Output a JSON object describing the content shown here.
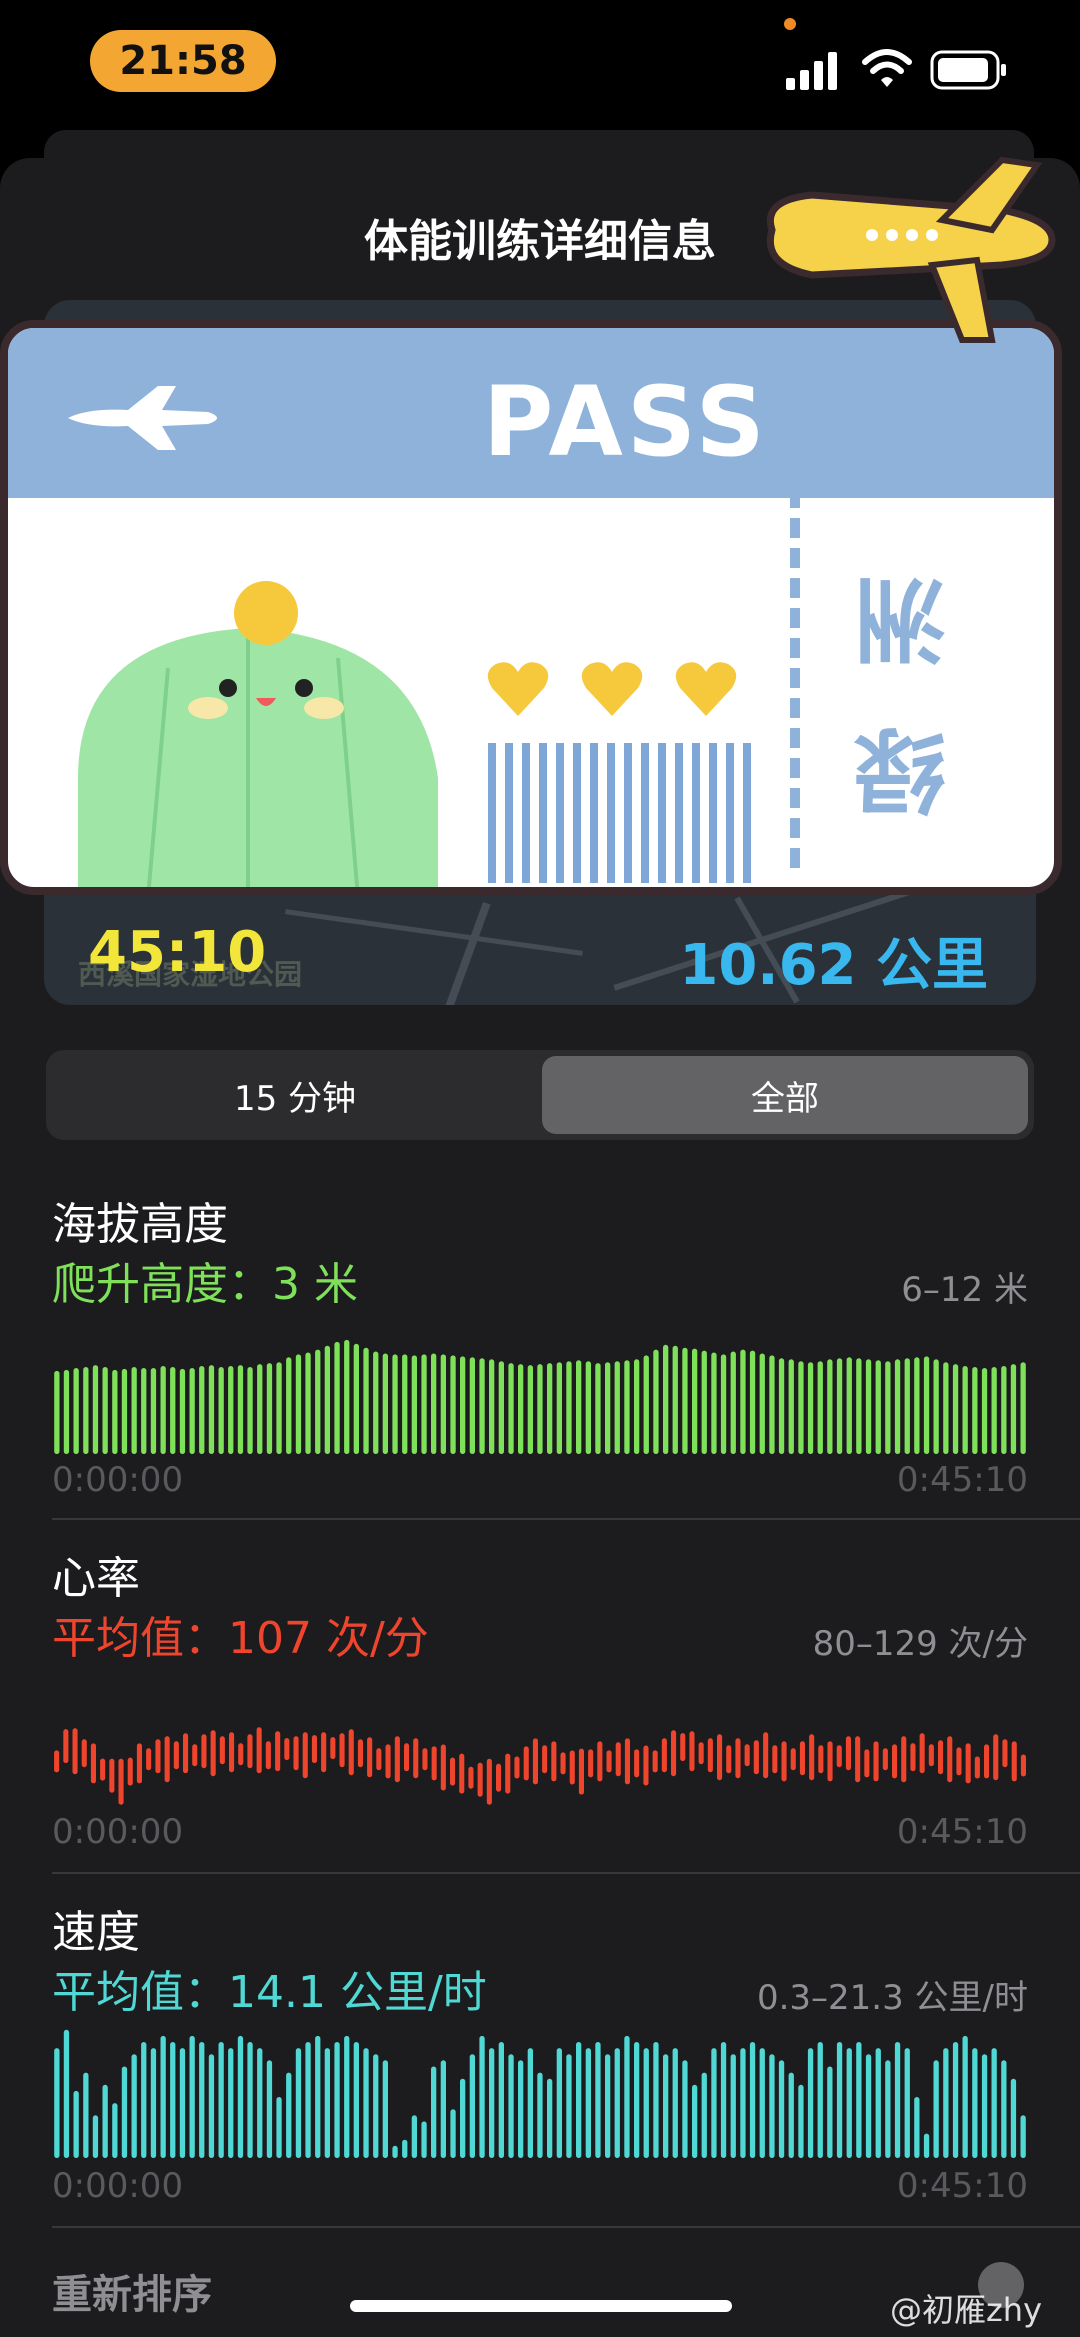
{
  "status_bar": {
    "time": "21:58",
    "icons": [
      "signal-icon",
      "wifi-icon",
      "battery-icon"
    ]
  },
  "sheet": {
    "title": "体能训练详细信息"
  },
  "map": {
    "duration": "45:10",
    "distance": "10.62 公里",
    "place_label": "西溪国家湿地公园"
  },
  "sticker": {
    "pass_text": "PASS",
    "destination": "绿洲"
  },
  "segmented": {
    "options": [
      "15 分钟",
      "全部"
    ],
    "selected": "全部"
  },
  "sections": [
    {
      "title": "海拔高度",
      "summary": "爬升高度：3 米",
      "range": "6–12 米",
      "axis_start": "0:00:00",
      "axis_end": "0:45:10",
      "color": "#7fe05a"
    },
    {
      "title": "心率",
      "summary": "平均值：107 次/分",
      "range": "80–129 次/分",
      "axis_start": "0:00:00",
      "axis_end": "0:45:10",
      "color": "#f0452d"
    },
    {
      "title": "速度",
      "summary": "平均值：14.1 公里/时",
      "range": "0.3–21.3 公里/时",
      "axis_start": "0:00:00",
      "axis_end": "0:45:10",
      "color": "#4fd8d4"
    }
  ],
  "footer": {
    "reorder_label": "重新排序",
    "watermark": "@初雁zhy"
  },
  "chart_data": [
    {
      "type": "bar",
      "title": "海拔高度",
      "ylabel": "米",
      "ylim": [
        0,
        12
      ],
      "x_range": [
        "0:00:00",
        "0:45:10"
      ],
      "values": [
        8.6,
        8.7,
        8.9,
        9.0,
        9.2,
        9.0,
        8.7,
        8.8,
        9.0,
        8.9,
        8.9,
        9.1,
        9.0,
        8.8,
        8.9,
        9.1,
        9.2,
        9.0,
        9.1,
        9.2,
        9.0,
        9.3,
        9.4,
        9.5,
        10.0,
        10.3,
        10.5,
        10.8,
        11.2,
        11.6,
        11.8,
        11.4,
        11.0,
        10.6,
        10.4,
        10.3,
        10.3,
        10.2,
        10.3,
        10.4,
        10.3,
        10.2,
        10.1,
        10.0,
        9.9,
        9.8,
        9.6,
        9.4,
        9.3,
        9.2,
        9.3,
        9.4,
        9.5,
        9.6,
        9.7,
        9.6,
        9.4,
        9.5,
        9.6,
        9.7,
        9.8,
        10.2,
        10.8,
        11.3,
        11.2,
        11.0,
        10.9,
        10.7,
        10.5,
        10.3,
        10.6,
        10.8,
        10.7,
        10.4,
        10.2,
        9.9,
        9.8,
        9.6,
        9.5,
        9.6,
        9.8,
        9.9,
        10.0,
        9.9,
        9.8,
        9.7,
        9.6,
        9.8,
        9.9,
        10.0,
        10.1,
        9.8,
        9.5,
        9.3,
        9.1,
        9.0,
        8.9,
        9.0,
        9.1,
        9.3,
        9.5
      ]
    },
    {
      "type": "bar",
      "title": "心率",
      "ylabel": "次/分",
      "ylim": [
        80,
        129
      ],
      "x_range": [
        "0:00:00",
        "0:45:10"
      ],
      "values": [
        110,
        125,
        120,
        118,
        108,
        102,
        96,
        90,
        100,
        108,
        112,
        115,
        112,
        116,
        118,
        116,
        120,
        118,
        121,
        119,
        117,
        120,
        121,
        116,
        120,
        122,
        118,
        116,
        122,
        119,
        123,
        121,
        119,
        118,
        114,
        112,
        110,
        112,
        114,
        113,
        112,
        108,
        104,
        100,
        98,
        94,
        92,
        90,
        94,
        98,
        104,
        108,
        110,
        112,
        110,
        108,
        104,
        100,
        108,
        110,
        110,
        112,
        110,
        108,
        106,
        110,
        116,
        118,
        124,
        120,
        118,
        116,
        114,
        112,
        113,
        116,
        114,
        116,
        112,
        110,
        112,
        113,
        114,
        112,
        110,
        115,
        118,
        112,
        108,
        110,
        112,
        110,
        112,
        114,
        118,
        116,
        114,
        112,
        110,
        108,
        104,
        110,
        114,
        118,
        110,
        106
      ]
    },
    {
      "type": "bar",
      "title": "速度",
      "ylabel": "公里/时",
      "ylim": [
        0,
        21.3
      ],
      "x_range": [
        "0:00:00",
        "0:45:10"
      ],
      "values": [
        18,
        21,
        11,
        14,
        7,
        12,
        9,
        15,
        17,
        19,
        18,
        20,
        19,
        18,
        20,
        19,
        17,
        19,
        18,
        20,
        19,
        18,
        16,
        10,
        14,
        18,
        19,
        20,
        18,
        19,
        20,
        19,
        18,
        17,
        16,
        2,
        3,
        7,
        6,
        15,
        16,
        8,
        13,
        17,
        20,
        18,
        19,
        17,
        16,
        18,
        14,
        13,
        18,
        17,
        19,
        18,
        19,
        17,
        18,
        20,
        19,
        18,
        19,
        17,
        18,
        16,
        12,
        14,
        18,
        19,
        17,
        18,
        19,
        18,
        17,
        16,
        14,
        12,
        18,
        19,
        15,
        19,
        18,
        19,
        17,
        18,
        16,
        19,
        18,
        10,
        4,
        16,
        18,
        19,
        20,
        18,
        17,
        18,
        16,
        13,
        7
      ]
    }
  ]
}
